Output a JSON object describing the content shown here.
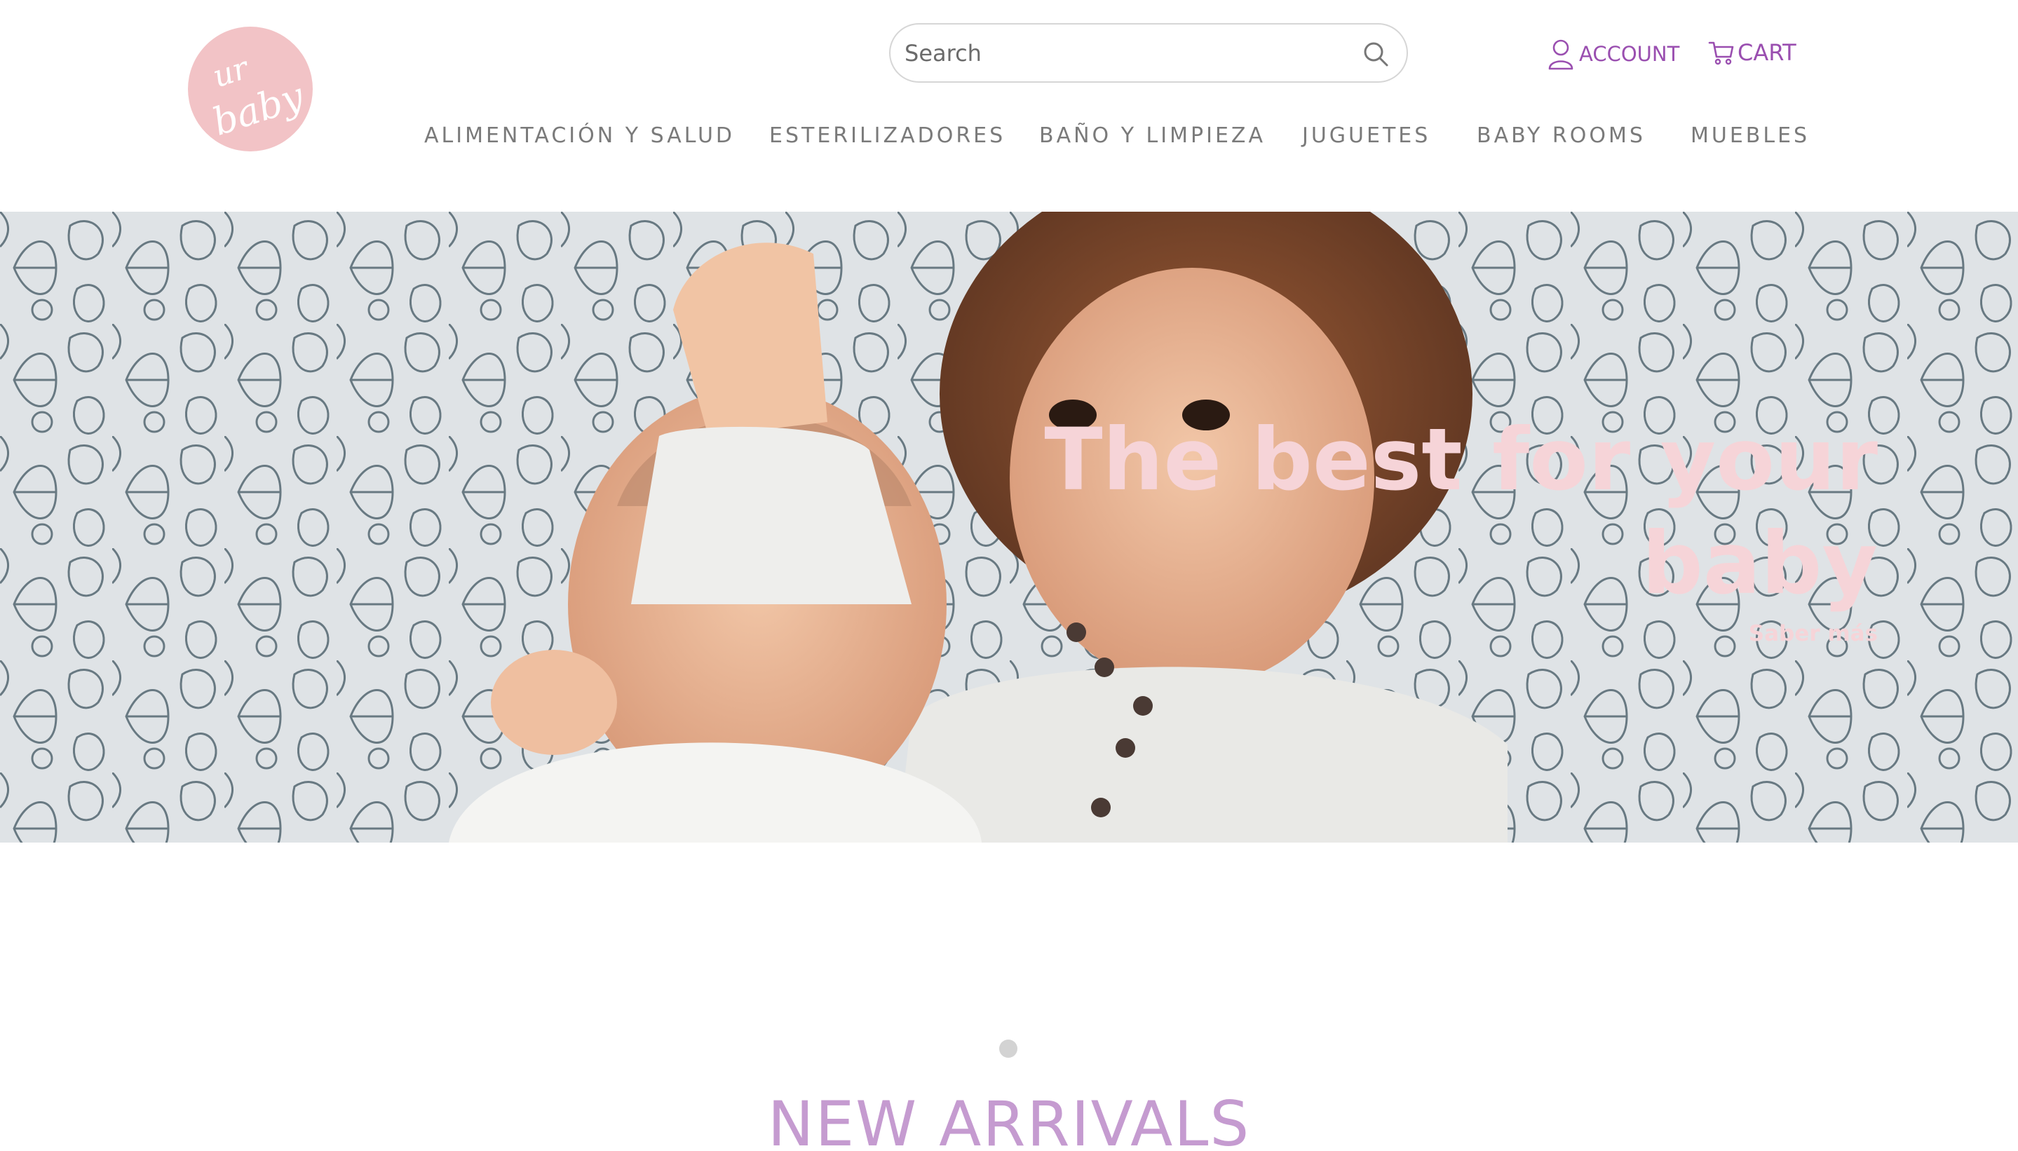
{
  "brand": {
    "logo_line1": "ur",
    "logo_line2": "baby",
    "logo_color": "#f2c3c6"
  },
  "search": {
    "placeholder": "Search",
    "icon": "search-icon"
  },
  "header_links": {
    "account": {
      "label": "ACCOUNT",
      "icon": "user-icon"
    },
    "cart": {
      "label": "CART",
      "icon": "cart-icon"
    },
    "accent_color": "#9a4fb0"
  },
  "nav": {
    "items": [
      {
        "label": "ALIMENTACIÓN Y SALUD"
      },
      {
        "label": "ESTERILIZADORES"
      },
      {
        "label": "BAÑO Y LIMPIEZA"
      },
      {
        "label": "JUGUETES"
      },
      {
        "label": "BABY ROOMS"
      },
      {
        "label": "MUEBLES"
      }
    ]
  },
  "hero": {
    "title": "The best for your baby",
    "cta": "Saber más",
    "text_color": "#f6d4d8"
  },
  "carousel": {
    "total_slides": 1,
    "active_slide": 1
  },
  "sections": {
    "new_arrivals_title": "NEW ARRIVALS",
    "title_color": "#c59bd0"
  }
}
